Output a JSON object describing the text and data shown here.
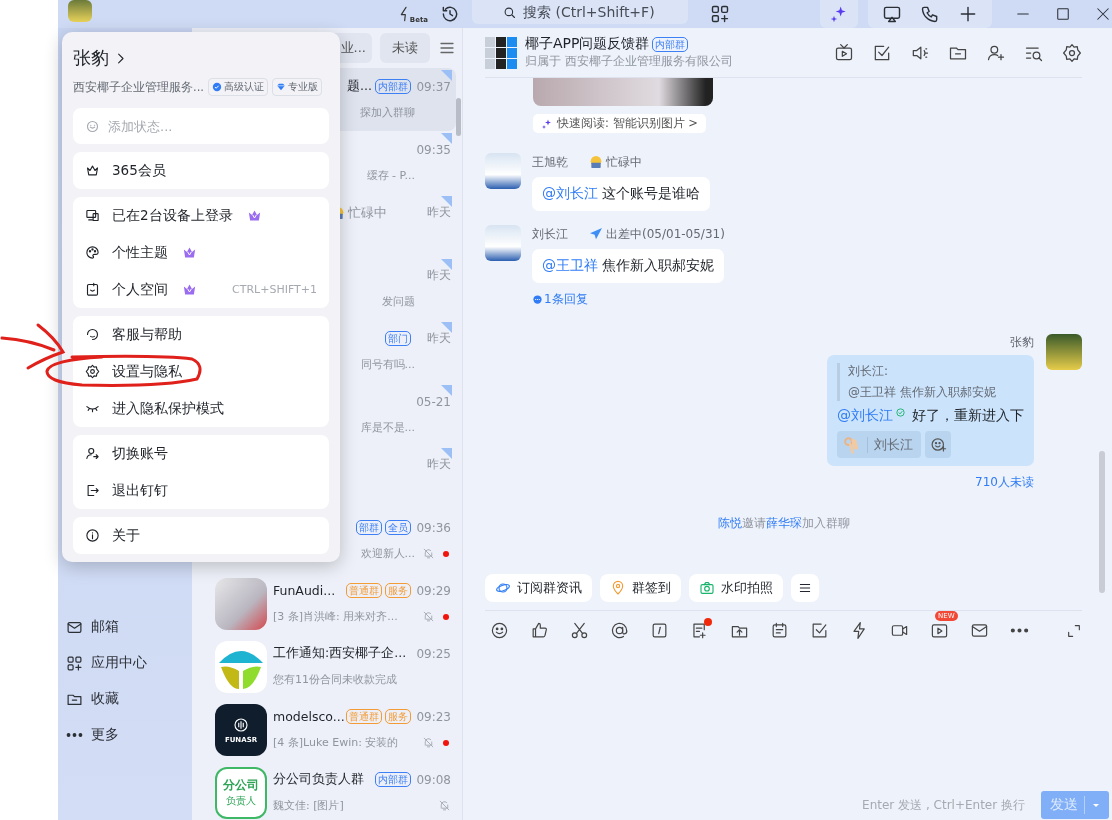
{
  "titlebar": {
    "beta_label": "Beta",
    "search": {
      "placeholder": "搜索 (Ctrl+Shift+F)"
    }
  },
  "sidebar": {
    "items": [
      {
        "label": "邮箱",
        "kind": "mail"
      },
      {
        "label": "应用中心",
        "kind": "apps"
      },
      {
        "label": "收藏",
        "kind": "folder"
      },
      {
        "label": "更多",
        "kind": "more"
      }
    ]
  },
  "conversation_list": {
    "tabs": [
      {
        "label": "业...",
        "selected": false
      },
      {
        "label": "未读",
        "selected": false
      }
    ],
    "rows": [
      {
        "title": "题...",
        "badges": [
          {
            "label": "内部群",
            "color": "#3d7ff5"
          }
        ],
        "time": "09:37",
        "preview": "探加入群聊",
        "selected": true,
        "pinned": true,
        "muted": false,
        "unread": false
      },
      {
        "time": "09:35",
        "preview": "缓存 - P...",
        "selected": false,
        "pinned": true,
        "muted": false,
        "unread": false
      },
      {
        "status": "忙碌中",
        "time": "昨天",
        "selected": false,
        "pinned": true,
        "muted": false,
        "unread": false
      },
      {
        "time": "昨天",
        "preview": "发问题",
        "selected": false,
        "pinned": true,
        "muted": false,
        "unread": false
      },
      {
        "badges": [
          {
            "label": "部门",
            "color": "#3d7ff5"
          }
        ],
        "time": "昨天",
        "preview": "同号有吗...",
        "selected": false,
        "pinned": true,
        "muted": false,
        "unread": false
      },
      {
        "time": "05-21",
        "preview": "库是不是...",
        "selected": false,
        "pinned": true,
        "muted": false,
        "unread": false
      },
      {
        "time": "昨天",
        "selected": false,
        "pinned": true,
        "muted": false,
        "unread": false
      },
      {
        "badges": [
          {
            "label": "部群",
            "color": "#3d7ff5"
          },
          {
            "label": "全员",
            "color": "#3d7ff5"
          }
        ],
        "time": "09:36",
        "preview": "欢迎新人...",
        "selected": false,
        "pinned": false,
        "muted": true,
        "unread": true
      },
      {
        "avatar": {
          "kind": "photo"
        },
        "title": "FunAudi...",
        "badges": [
          {
            "label": "普通群",
            "color": "#f39b34"
          },
          {
            "label": "服务",
            "color": "#f39b34"
          }
        ],
        "time": "09:29",
        "preview": "[3 条]肖洪峰: 用来对齐...",
        "selected": false,
        "pinned": false,
        "muted": true,
        "unread": true
      },
      {
        "avatar": {
          "kind": "palm"
        },
        "title": "工作通知:西安椰子企...",
        "time": "09:25",
        "preview": "您有11份合同未收款完成",
        "selected": false,
        "pinned": false,
        "muted": false,
        "unread": false
      },
      {
        "avatar": {
          "kind": "logo",
          "text": "FUNASR"
        },
        "title": "modelsco...",
        "badges": [
          {
            "label": "普通群",
            "color": "#f39b34"
          },
          {
            "label": "服务",
            "color": "#f39b34"
          }
        ],
        "time": "09:23",
        "preview": "[4 条]Luke Ewin: 安装的",
        "selected": false,
        "pinned": false,
        "muted": true,
        "unread": true
      },
      {
        "avatar": {
          "kind": "text",
          "lines": [
            "分公司",
            "负责人"
          ]
        },
        "title": "分公司负责人群",
        "badges": [
          {
            "label": "内部群",
            "color": "#3d7ff5"
          }
        ],
        "time": "09:08",
        "preview": "魏文佳: [图片]",
        "selected": false,
        "pinned": false,
        "muted": true,
        "unread": false
      }
    ]
  },
  "profile_menu": {
    "name": "张豹",
    "company": "西安椰子企业管理服务...",
    "badges": [
      {
        "label": "高级认证",
        "kind": "verified"
      },
      {
        "label": "专业版",
        "kind": "pro"
      }
    ],
    "status_field": {
      "placeholder": "添加状态..."
    },
    "groups": [
      {
        "items": [
          {
            "label": "365会员",
            "kind": "crown",
            "premium": false
          }
        ]
      },
      {
        "items": [
          {
            "label": "已在2台设备上登录",
            "kind": "devices",
            "premium": true
          },
          {
            "label": "个性主题",
            "kind": "palette",
            "premium": true
          },
          {
            "label": "个人空间",
            "kind": "space",
            "premium": true,
            "shortcut": "CTRL+SHIFT+1"
          }
        ]
      },
      {
        "items": [
          {
            "label": "客服与帮助",
            "kind": "help",
            "premium": false
          },
          {
            "label": "设置与隐私",
            "kind": "gear",
            "premium": false
          },
          {
            "label": "进入隐私保护模式",
            "kind": "eyeclosed",
            "premium": false
          }
        ]
      },
      {
        "items": [
          {
            "label": "切换账号",
            "kind": "switchuser",
            "premium": false
          },
          {
            "label": "退出钉钉",
            "kind": "logout",
            "premium": false
          }
        ]
      },
      {
        "items": [
          {
            "label": "关于",
            "kind": "info",
            "premium": false
          }
        ]
      }
    ]
  },
  "chat": {
    "title": "椰子APP问题反馈群",
    "badge": {
      "label": "内部群",
      "color": "#3d7ff5"
    },
    "subtitle": "归属于 西安椰子企业管理服务有限公司",
    "messages": [
      {
        "kind": "image"
      },
      {
        "kind": "quickread",
        "text": "快速阅读: 智能识别图片 >"
      },
      {
        "kind": "incoming",
        "sender": "王旭乾",
        "status": {
          "kind": "busy",
          "label": "忙碌中"
        },
        "mention": "@刘长江",
        "text": "这个账号是谁哈"
      },
      {
        "kind": "incoming",
        "sender": "刘长江",
        "status": {
          "kind": "trip",
          "label": "出差中(05/01-05/31)"
        },
        "mention": "@王卫祥",
        "text": "焦作新入职郝安妮",
        "replies": "1条回复"
      },
      {
        "kind": "outgoing",
        "sender": "张豹",
        "quote_author": "刘长江:",
        "quote_text": "@王卫祥 焦作新入职郝安妮",
        "mention": "@刘长江",
        "mention_read": true,
        "text": "好了，重新进入下",
        "reactions": [
          {
            "name": "刘长江"
          }
        ],
        "receipt": "710人未读"
      },
      {
        "kind": "system",
        "inviter": "陈悦",
        "verb": "邀请",
        "invitee": "薛华琛",
        "tail": "加入群聊"
      }
    ],
    "quick_actions": [
      {
        "label": "订阅群资讯",
        "kind": "subscribe"
      },
      {
        "label": "群签到",
        "kind": "checkin"
      },
      {
        "label": "水印拍照",
        "kind": "camera"
      }
    ],
    "toolbar": [
      {
        "kind": "emoji"
      },
      {
        "kind": "like"
      },
      {
        "kind": "scissors"
      },
      {
        "kind": "at"
      },
      {
        "kind": "slash"
      },
      {
        "kind": "note",
        "dot": true
      },
      {
        "kind": "upload"
      },
      {
        "kind": "calendar"
      },
      {
        "kind": "check"
      },
      {
        "kind": "flash"
      },
      {
        "kind": "video"
      },
      {
        "kind": "live",
        "badge": "NEW"
      },
      {
        "kind": "mail"
      },
      {
        "kind": "more"
      }
    ],
    "composer": {
      "hint": "Enter 发送 , Ctrl+Enter 换行",
      "send_label": "发送",
      "send_disabled": true
    }
  }
}
